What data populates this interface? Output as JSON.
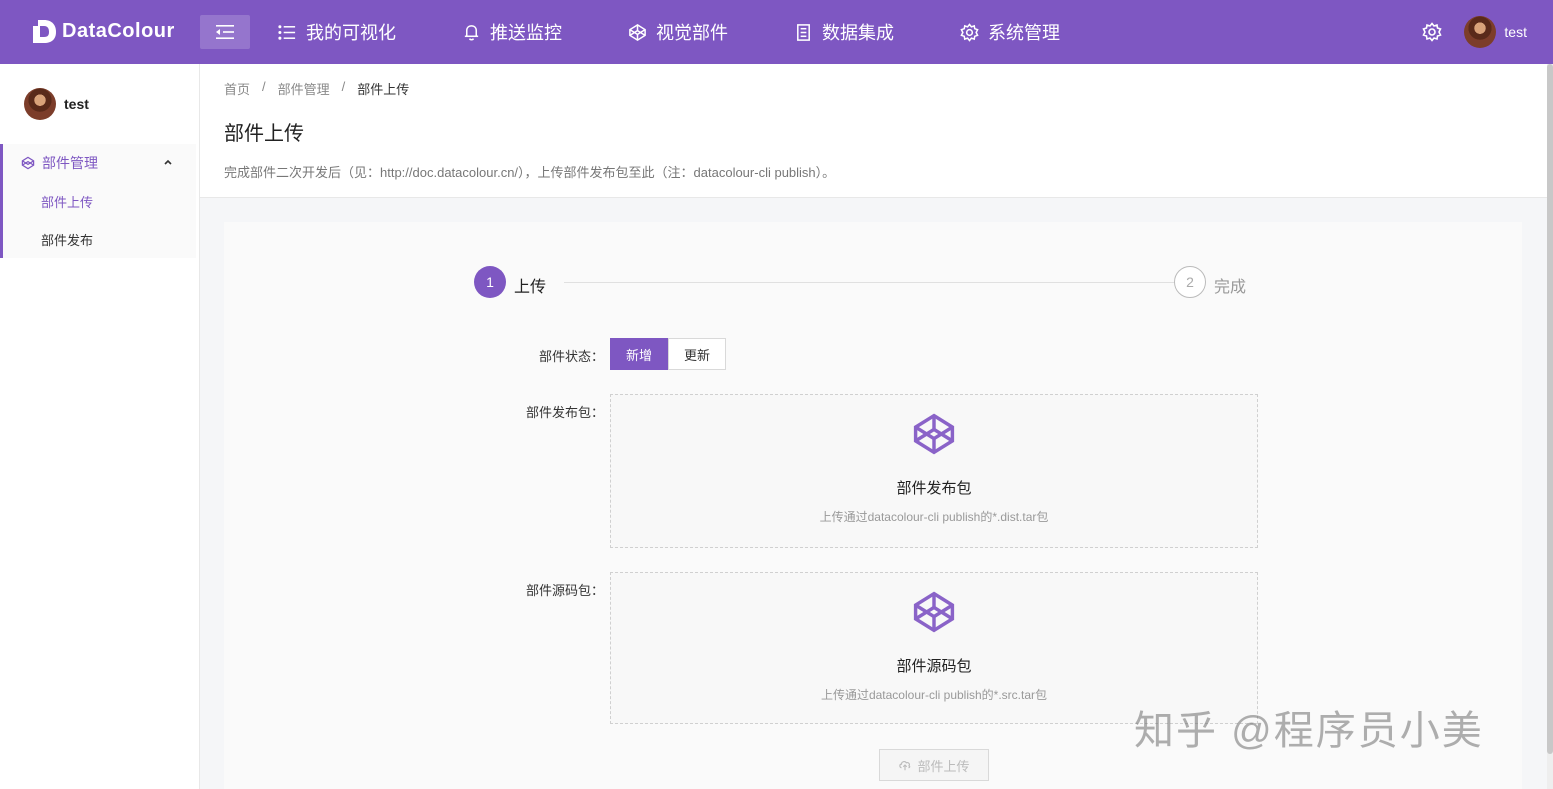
{
  "app": {
    "logo_text": "DataColour"
  },
  "nav": {
    "items": [
      {
        "label": "我的可视化",
        "icon": "list-icon"
      },
      {
        "label": "推送监控",
        "icon": "bell-icon"
      },
      {
        "label": "视觉部件",
        "icon": "codepen-icon"
      },
      {
        "label": "数据集成",
        "icon": "document-icon"
      },
      {
        "label": "系统管理",
        "icon": "gear-icon"
      }
    ],
    "user": "test"
  },
  "sidebar": {
    "user": "test",
    "group": {
      "label": "部件管理"
    },
    "items": [
      {
        "label": "部件上传",
        "active": true
      },
      {
        "label": "部件发布",
        "active": false
      }
    ]
  },
  "header": {
    "breadcrumb": [
      "首页",
      "部件管理",
      "部件上传"
    ],
    "separator": "/",
    "title": "部件上传",
    "description": "完成部件二次开发后（见：http://doc.datacolour.cn/），上传部件发布包至此（注：datacolour-cli publish）。"
  },
  "steps": [
    {
      "num": "1",
      "label": "上传"
    },
    {
      "num": "2",
      "label": "完成"
    }
  ],
  "form": {
    "status_label": "部件状态：",
    "status_options": [
      "新增",
      "更新"
    ],
    "dist_label": "部件发布包：",
    "dist_title": "部件发布包",
    "dist_hint": "上传通过datacolour-cli publish的*.dist.tar包",
    "src_label": "部件源码包：",
    "src_title": "部件源码包",
    "src_hint": "上传通过datacolour-cli publish的*.src.tar包",
    "upload_button": "部件上传"
  },
  "watermark": "知乎 @程序员小美",
  "colors": {
    "accent": "#7e57c2"
  }
}
